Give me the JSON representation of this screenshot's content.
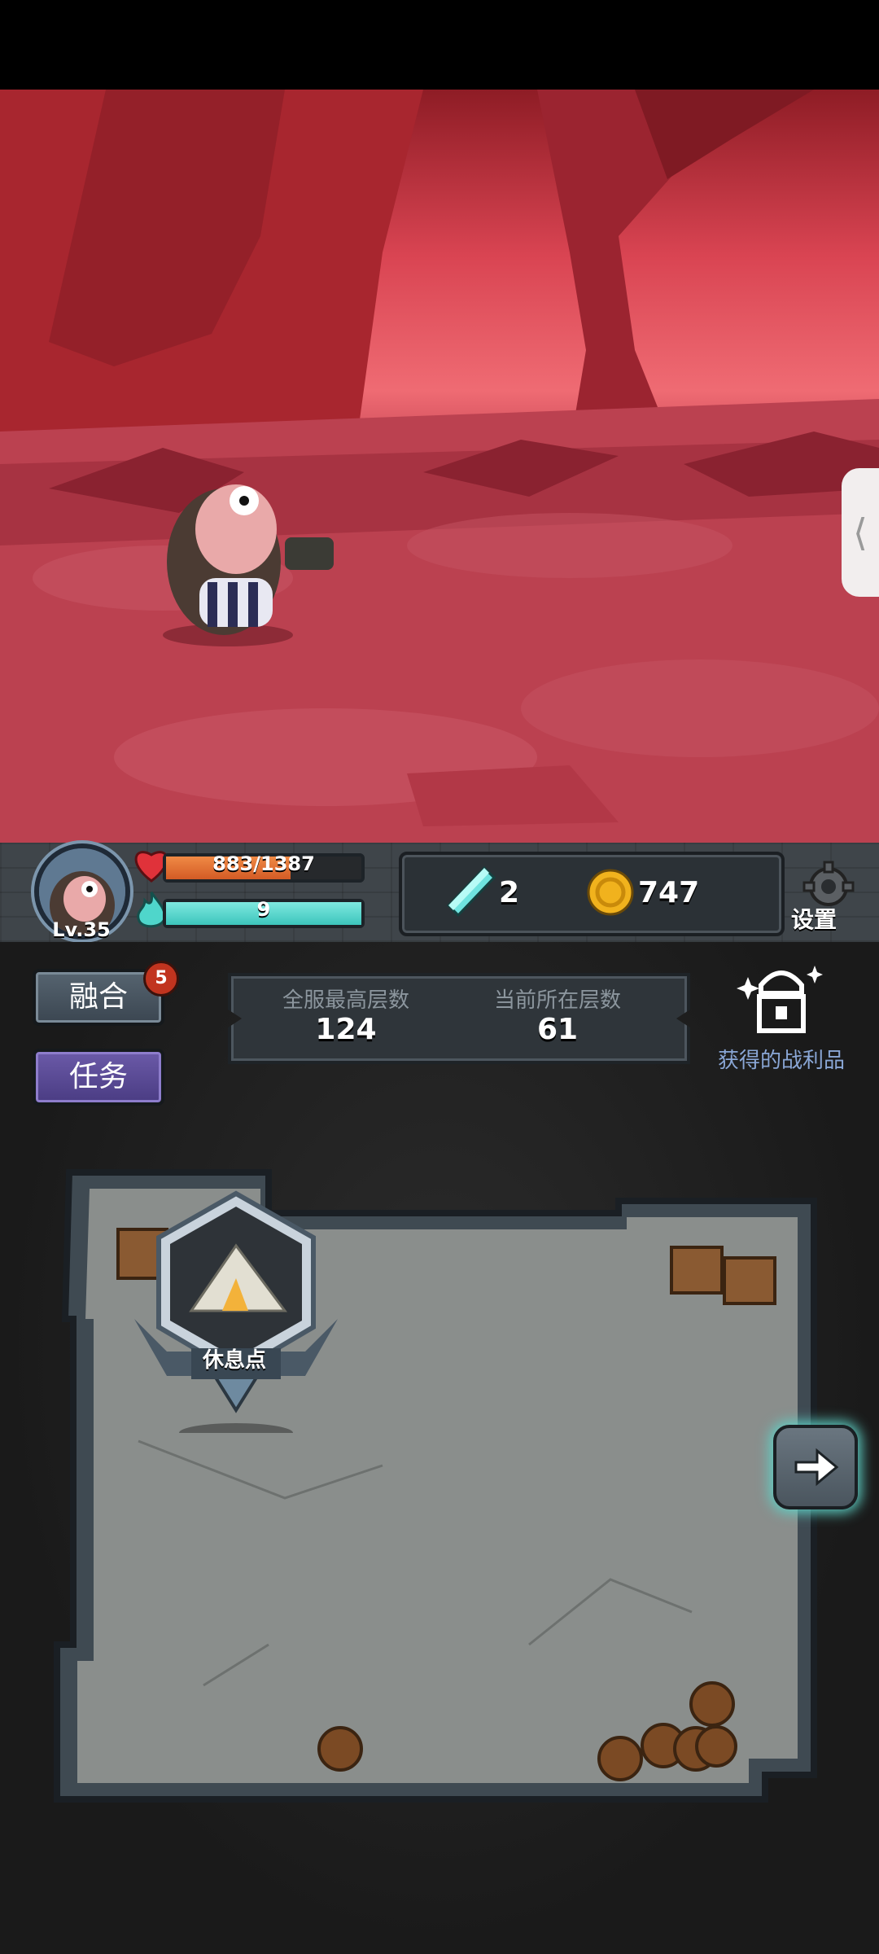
{
  "player": {
    "level": "Lv.35",
    "hp_text": "883/1387",
    "hp_ratio": 0.6366,
    "mana_text": "9",
    "mana_ratio": 1.0
  },
  "currency": {
    "gems": "2",
    "gold": "747",
    "gem_icon": "crystal-icon",
    "gold_icon": "gold-coin-icon"
  },
  "settings": {
    "label": "设置",
    "icon": "gear-icon"
  },
  "side_tab": {
    "icon": "chevron-left-icon",
    "glyph": "⟨"
  },
  "buttons": {
    "fuse": "融合",
    "fuse_badge": "5",
    "task": "任务"
  },
  "floors": {
    "server_best_label": "全服最高层数",
    "server_best_value": "124",
    "current_label": "当前所在层数",
    "current_value": "61"
  },
  "loot": {
    "label": "获得的战利品",
    "icon": "treasure-chest-icon"
  },
  "room": {
    "rest_point_label": "休息点",
    "next_icon": "arrow-right-icon"
  },
  "colors": {
    "hp": "#e06a30",
    "mana": "#4fd6cb",
    "task_button": "#5a4a9a",
    "badge": "#c1341f",
    "loot_text": "#8aa7d6"
  }
}
